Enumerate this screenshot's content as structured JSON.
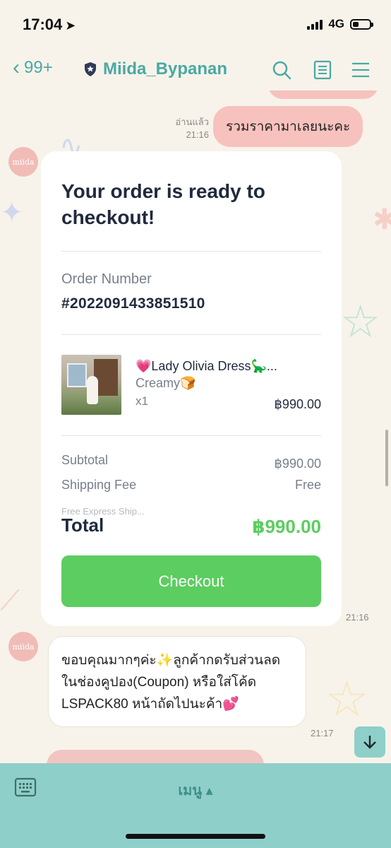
{
  "status": {
    "time": "17:04",
    "network": "4G"
  },
  "header": {
    "back_count": "99+",
    "title": "Miida_Bypanan"
  },
  "chat": {
    "prev_message": {
      "read_label": "อ่านแล้ว",
      "time": "21:16",
      "text": "รวมราคามาเลยนะคะ"
    },
    "avatar_label": "miida",
    "order_card": {
      "title": "Your order is ready to checkout!",
      "order_number_label": "Order Number",
      "order_number": "#2022091433851510",
      "product": {
        "name": "💗Lady Olivia Dress🦕...",
        "variant": "Creamy🍞",
        "qty": "x1",
        "price": "฿990.00"
      },
      "subtotal_label": "Subtotal",
      "subtotal_value": "฿990.00",
      "shipping_label": "Shipping Fee",
      "shipping_value": "Free",
      "shipping_note": "Free Express Ship...",
      "total_label": "Total",
      "total_value": "฿990.00",
      "checkout_label": "Checkout",
      "time": "21:16"
    },
    "incoming_message": {
      "text": "ขอบคุณมากๆค่ะ✨ลูกค้ากดรับส่วนลดในช่องคูปอง(Coupon) หรือใส่โค้ด LSPACK80 หน้าถัดไปนะค้า💕",
      "time": "21:17"
    }
  },
  "bottom": {
    "menu_label": "เมนู ▴"
  },
  "colors": {
    "accent": "#4aa9a3",
    "checkout_green": "#5ccd60",
    "outgoing_bubble": "#f7c2bd",
    "bottom_bar": "#8fcfc9"
  }
}
